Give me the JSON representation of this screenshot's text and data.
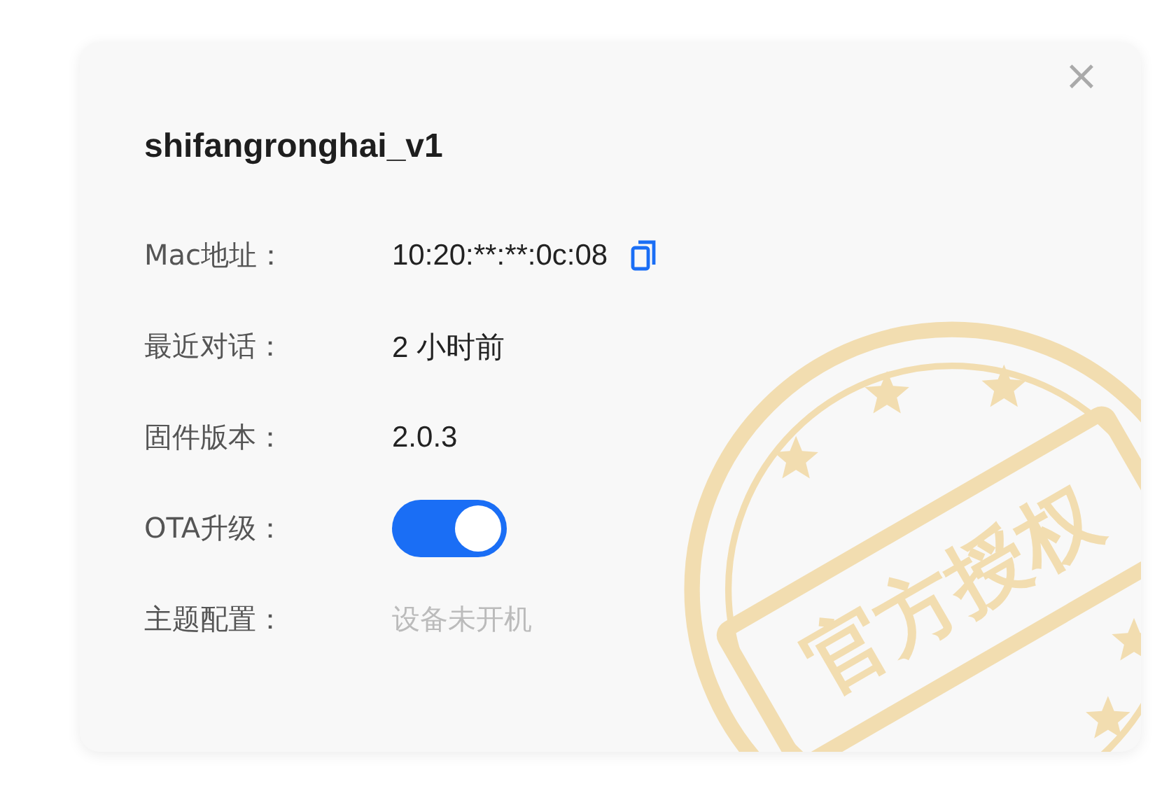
{
  "card": {
    "title": "shifangronghai_v1",
    "close": "×",
    "fields": [
      {
        "label": "Mac地址：",
        "kind": "copy",
        "value": "10:20:**:**:0c:08"
      },
      {
        "label": "最近对话：",
        "kind": "text",
        "value": "2 小时前"
      },
      {
        "label": "固件版本：",
        "kind": "text",
        "value": "2.0.3"
      },
      {
        "label": "OTA升级：",
        "kind": "toggle",
        "on": true
      },
      {
        "label": "主题配置：",
        "kind": "placeholder",
        "value": "设备未开机"
      }
    ],
    "stamp": {
      "text": "官方授权"
    }
  }
}
